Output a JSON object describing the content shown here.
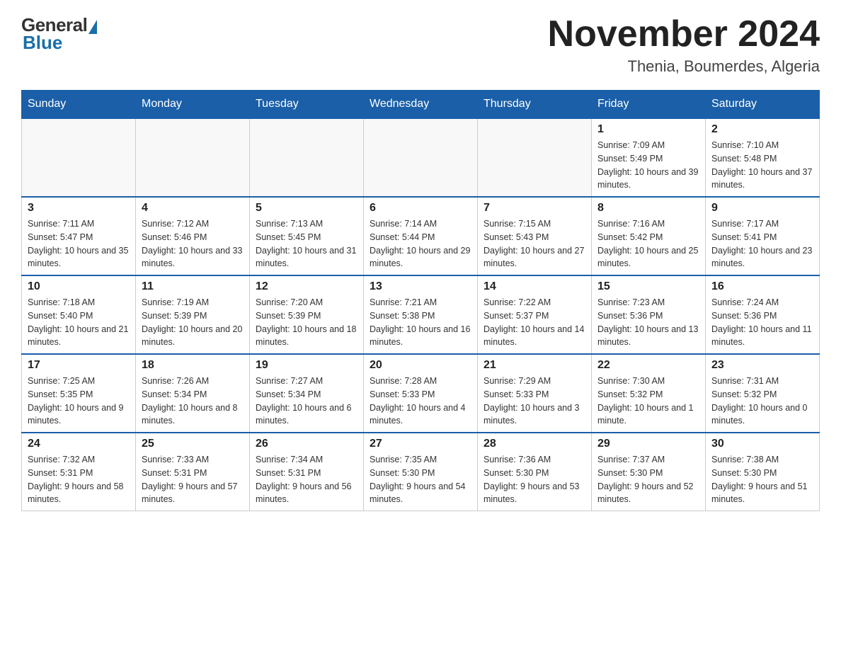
{
  "logo": {
    "general": "General",
    "blue": "Blue",
    "triangle_color": "#1a6fa8"
  },
  "header": {
    "month_title": "November 2024",
    "subtitle": "Thenia, Boumerdes, Algeria"
  },
  "days_of_week": [
    "Sunday",
    "Monday",
    "Tuesday",
    "Wednesday",
    "Thursday",
    "Friday",
    "Saturday"
  ],
  "weeks": [
    [
      {
        "day": "",
        "sunrise": "",
        "sunset": "",
        "daylight": ""
      },
      {
        "day": "",
        "sunrise": "",
        "sunset": "",
        "daylight": ""
      },
      {
        "day": "",
        "sunrise": "",
        "sunset": "",
        "daylight": ""
      },
      {
        "day": "",
        "sunrise": "",
        "sunset": "",
        "daylight": ""
      },
      {
        "day": "",
        "sunrise": "",
        "sunset": "",
        "daylight": ""
      },
      {
        "day": "1",
        "sunrise": "Sunrise: 7:09 AM",
        "sunset": "Sunset: 5:49 PM",
        "daylight": "Daylight: 10 hours and 39 minutes."
      },
      {
        "day": "2",
        "sunrise": "Sunrise: 7:10 AM",
        "sunset": "Sunset: 5:48 PM",
        "daylight": "Daylight: 10 hours and 37 minutes."
      }
    ],
    [
      {
        "day": "3",
        "sunrise": "Sunrise: 7:11 AM",
        "sunset": "Sunset: 5:47 PM",
        "daylight": "Daylight: 10 hours and 35 minutes."
      },
      {
        "day": "4",
        "sunrise": "Sunrise: 7:12 AM",
        "sunset": "Sunset: 5:46 PM",
        "daylight": "Daylight: 10 hours and 33 minutes."
      },
      {
        "day": "5",
        "sunrise": "Sunrise: 7:13 AM",
        "sunset": "Sunset: 5:45 PM",
        "daylight": "Daylight: 10 hours and 31 minutes."
      },
      {
        "day": "6",
        "sunrise": "Sunrise: 7:14 AM",
        "sunset": "Sunset: 5:44 PM",
        "daylight": "Daylight: 10 hours and 29 minutes."
      },
      {
        "day": "7",
        "sunrise": "Sunrise: 7:15 AM",
        "sunset": "Sunset: 5:43 PM",
        "daylight": "Daylight: 10 hours and 27 minutes."
      },
      {
        "day": "8",
        "sunrise": "Sunrise: 7:16 AM",
        "sunset": "Sunset: 5:42 PM",
        "daylight": "Daylight: 10 hours and 25 minutes."
      },
      {
        "day": "9",
        "sunrise": "Sunrise: 7:17 AM",
        "sunset": "Sunset: 5:41 PM",
        "daylight": "Daylight: 10 hours and 23 minutes."
      }
    ],
    [
      {
        "day": "10",
        "sunrise": "Sunrise: 7:18 AM",
        "sunset": "Sunset: 5:40 PM",
        "daylight": "Daylight: 10 hours and 21 minutes."
      },
      {
        "day": "11",
        "sunrise": "Sunrise: 7:19 AM",
        "sunset": "Sunset: 5:39 PM",
        "daylight": "Daylight: 10 hours and 20 minutes."
      },
      {
        "day": "12",
        "sunrise": "Sunrise: 7:20 AM",
        "sunset": "Sunset: 5:39 PM",
        "daylight": "Daylight: 10 hours and 18 minutes."
      },
      {
        "day": "13",
        "sunrise": "Sunrise: 7:21 AM",
        "sunset": "Sunset: 5:38 PM",
        "daylight": "Daylight: 10 hours and 16 minutes."
      },
      {
        "day": "14",
        "sunrise": "Sunrise: 7:22 AM",
        "sunset": "Sunset: 5:37 PM",
        "daylight": "Daylight: 10 hours and 14 minutes."
      },
      {
        "day": "15",
        "sunrise": "Sunrise: 7:23 AM",
        "sunset": "Sunset: 5:36 PM",
        "daylight": "Daylight: 10 hours and 13 minutes."
      },
      {
        "day": "16",
        "sunrise": "Sunrise: 7:24 AM",
        "sunset": "Sunset: 5:36 PM",
        "daylight": "Daylight: 10 hours and 11 minutes."
      }
    ],
    [
      {
        "day": "17",
        "sunrise": "Sunrise: 7:25 AM",
        "sunset": "Sunset: 5:35 PM",
        "daylight": "Daylight: 10 hours and 9 minutes."
      },
      {
        "day": "18",
        "sunrise": "Sunrise: 7:26 AM",
        "sunset": "Sunset: 5:34 PM",
        "daylight": "Daylight: 10 hours and 8 minutes."
      },
      {
        "day": "19",
        "sunrise": "Sunrise: 7:27 AM",
        "sunset": "Sunset: 5:34 PM",
        "daylight": "Daylight: 10 hours and 6 minutes."
      },
      {
        "day": "20",
        "sunrise": "Sunrise: 7:28 AM",
        "sunset": "Sunset: 5:33 PM",
        "daylight": "Daylight: 10 hours and 4 minutes."
      },
      {
        "day": "21",
        "sunrise": "Sunrise: 7:29 AM",
        "sunset": "Sunset: 5:33 PM",
        "daylight": "Daylight: 10 hours and 3 minutes."
      },
      {
        "day": "22",
        "sunrise": "Sunrise: 7:30 AM",
        "sunset": "Sunset: 5:32 PM",
        "daylight": "Daylight: 10 hours and 1 minute."
      },
      {
        "day": "23",
        "sunrise": "Sunrise: 7:31 AM",
        "sunset": "Sunset: 5:32 PM",
        "daylight": "Daylight: 10 hours and 0 minutes."
      }
    ],
    [
      {
        "day": "24",
        "sunrise": "Sunrise: 7:32 AM",
        "sunset": "Sunset: 5:31 PM",
        "daylight": "Daylight: 9 hours and 58 minutes."
      },
      {
        "day": "25",
        "sunrise": "Sunrise: 7:33 AM",
        "sunset": "Sunset: 5:31 PM",
        "daylight": "Daylight: 9 hours and 57 minutes."
      },
      {
        "day": "26",
        "sunrise": "Sunrise: 7:34 AM",
        "sunset": "Sunset: 5:31 PM",
        "daylight": "Daylight: 9 hours and 56 minutes."
      },
      {
        "day": "27",
        "sunrise": "Sunrise: 7:35 AM",
        "sunset": "Sunset: 5:30 PM",
        "daylight": "Daylight: 9 hours and 54 minutes."
      },
      {
        "day": "28",
        "sunrise": "Sunrise: 7:36 AM",
        "sunset": "Sunset: 5:30 PM",
        "daylight": "Daylight: 9 hours and 53 minutes."
      },
      {
        "day": "29",
        "sunrise": "Sunrise: 7:37 AM",
        "sunset": "Sunset: 5:30 PM",
        "daylight": "Daylight: 9 hours and 52 minutes."
      },
      {
        "day": "30",
        "sunrise": "Sunrise: 7:38 AM",
        "sunset": "Sunset: 5:30 PM",
        "daylight": "Daylight: 9 hours and 51 minutes."
      }
    ]
  ]
}
